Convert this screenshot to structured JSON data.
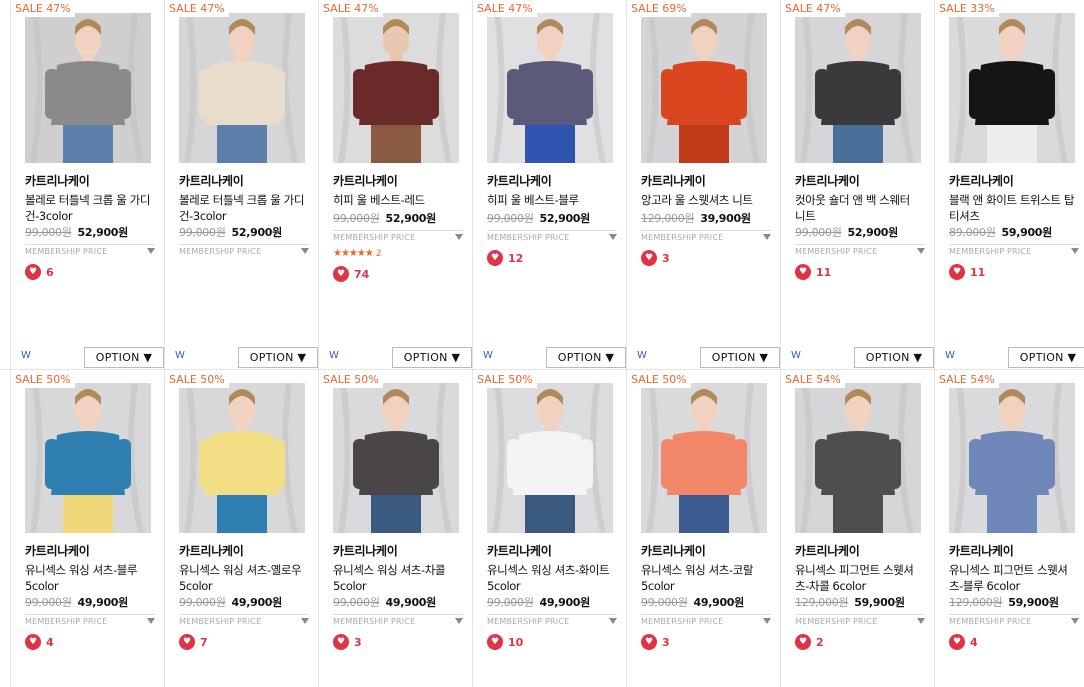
{
  "membership_label": "MEMBERSHIP PRICE",
  "brand_name": "카트리나케이",
  "option_label": "OPTION ▼",
  "w_label": "W",
  "rows": [
    [
      {
        "sale": "SALE 47%",
        "name": "볼레로 터틀넥 크롭 울 가디건-3color",
        "orig": "99,000원",
        "price": "52,900원",
        "likes": "6",
        "rating": null,
        "reviews": null,
        "palette": [
          "#cfcfd0",
          "#8a8a8a",
          "#f1d2c0",
          "#5b7fa8"
        ]
      },
      {
        "sale": "SALE 47%",
        "name": "볼레로 터틀넥 크롭 울 가디건-3color",
        "orig": "99,000원",
        "price": "52,900원",
        "likes": null,
        "rating": null,
        "reviews": null,
        "palette": [
          "#d6d6d8",
          "#e8dccb",
          "#f1d2c0",
          "#5b7fa8"
        ]
      },
      {
        "sale": "SALE 47%",
        "name": "히피 울 베스트-레드",
        "orig": "99,000원",
        "price": "52,900원",
        "likes": "74",
        "rating": "★★★★★",
        "reviews": "2",
        "palette": [
          "#dcdcdc",
          "#6b2a2a",
          "#e8c8b0",
          "#8a5a40"
        ]
      },
      {
        "sale": "SALE 47%",
        "name": "히피 울 베스트-블루",
        "orig": "99,000원",
        "price": "52,900원",
        "likes": "12",
        "rating": null,
        "reviews": null,
        "palette": [
          "#e0e0e2",
          "#5b5a7a",
          "#f1d2c0",
          "#2f55b0"
        ]
      },
      {
        "sale": "SALE 69%",
        "name": "앙고라 울 스웻셔츠 니트",
        "orig": "129,000원",
        "price": "39,900원",
        "likes": "3",
        "rating": null,
        "reviews": null,
        "palette": [
          "#d4d4d6",
          "#d9461f",
          "#f1d2c0",
          "#c03a1a"
        ]
      },
      {
        "sale": "SALE 47%",
        "name": "컷아웃 숄더 앤 백 스웨터 니트",
        "orig": "99,000원",
        "price": "52,900원",
        "likes": "11",
        "rating": null,
        "reviews": null,
        "palette": [
          "#d6d6d8",
          "#3a3a3c",
          "#f1d2c0",
          "#4a6f9a"
        ]
      },
      {
        "sale": "SALE 33%",
        "name": "블랙 앤 화이트 트위스트 탑 티셔츠",
        "orig": "89,000원",
        "price": "59,900원",
        "likes": "11",
        "rating": null,
        "reviews": null,
        "palette": [
          "#dadadc",
          "#151515",
          "#f1d2c0",
          "#eeeeee"
        ]
      }
    ],
    [
      {
        "sale": "SALE 50%",
        "name": "유니섹스 워싱 셔츠-블루 5color",
        "orig": "99,000원",
        "price": "49,900원",
        "likes": "4",
        "palette": [
          "#d8d8da",
          "#2f7fb0",
          "#f1d2c0",
          "#f0d87a"
        ]
      },
      {
        "sale": "SALE 50%",
        "name": "유니섹스 워싱 셔츠-옐로우 5color",
        "orig": "99,000원",
        "price": "49,900원",
        "likes": "7",
        "palette": [
          "#d8d8da",
          "#f2df85",
          "#f1d2c0",
          "#2f7fb0"
        ]
      },
      {
        "sale": "SALE 50%",
        "name": "유니섹스 워싱 셔츠-차콜 5color",
        "orig": "99,000원",
        "price": "49,900원",
        "likes": "3",
        "palette": [
          "#dadadc",
          "#4a4546",
          "#f1d2c0",
          "#3a5a80"
        ]
      },
      {
        "sale": "SALE 50%",
        "name": "유니섹스 워싱 셔츠-화이트 5color",
        "orig": "99,000원",
        "price": "49,900원",
        "likes": "10",
        "palette": [
          "#dcdcde",
          "#f4f4f4",
          "#f1d2c0",
          "#3a5a80"
        ]
      },
      {
        "sale": "SALE 50%",
        "name": "유니섹스 워싱 셔츠-코랄 5color",
        "orig": "99,000원",
        "price": "49,900원",
        "likes": "3",
        "palette": [
          "#dadadc",
          "#f2876a",
          "#f1d2c0",
          "#3a5a90"
        ]
      },
      {
        "sale": "SALE 54%",
        "name": "유니섹스 피그먼트 스웻셔츠-차콜 6color",
        "orig": "129,000원",
        "price": "59,900원",
        "likes": "2",
        "palette": [
          "#d6d6d8",
          "#4e4e50",
          "#f1d2c0",
          "#4e4e50"
        ]
      },
      {
        "sale": "SALE 54%",
        "name": "유니섹스 피그먼트 스웻셔츠-블루 6color",
        "orig": "129,000원",
        "price": "59,900원",
        "likes": "4",
        "palette": [
          "#dadadc",
          "#6f86b8",
          "#f1d2c0",
          "#6f86b8"
        ]
      }
    ]
  ]
}
